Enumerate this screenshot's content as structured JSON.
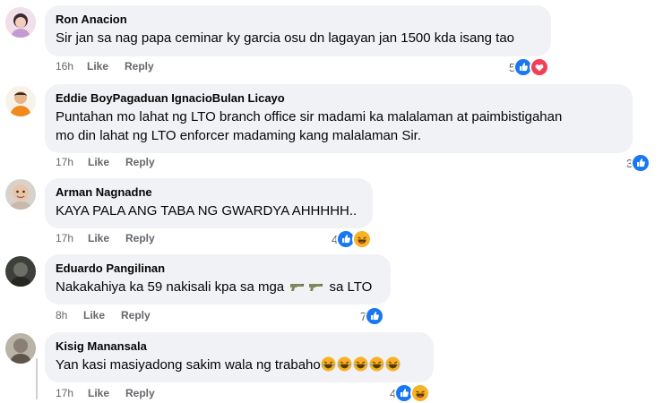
{
  "comments": [
    {
      "author": "Ron Anacion",
      "text": "Sir jan sa nag papa ceminar ky garcia osu dn lagayan jan 1500 kda isang tao",
      "time": "16h",
      "like_label": "Like",
      "reply_label": "Reply",
      "reaction_count": "5",
      "reactions": [
        "like-icon",
        "love-icon"
      ]
    },
    {
      "author": "Eddie BoyPagaduan IgnacioBulan Licayo",
      "text_lines": [
        "Puntahan mo lahat ng LTO branch office sir madami ka malalaman at paimbistigahan",
        "mo din lahat ng LTO enforcer madaming kang malalaman Sir."
      ],
      "time": "17h",
      "like_label": "Like",
      "reply_label": "Reply",
      "reaction_count": "3",
      "reactions": [
        "like-icon"
      ]
    },
    {
      "author": "Arman Nagnadne",
      "text": "KAYA PALA ANG TABA NG GWARDYA AHHHHH..",
      "time": "17h",
      "like_label": "Like",
      "reply_label": "Reply",
      "reaction_count": "4",
      "reactions": [
        "like-icon",
        "haha-icon"
      ]
    },
    {
      "author": "Eduardo Pangilinan",
      "text_before": "Nakakahiya ka 59 nakisali kpa sa mga",
      "text_after": "sa LTO",
      "inline_icons": [
        "gun-icon",
        "gun-icon"
      ],
      "time": "8h",
      "like_label": "Like",
      "reply_label": "Reply",
      "reaction_count": "7",
      "reactions": [
        "like-icon"
      ]
    },
    {
      "author": "Kisig Manansala",
      "text": "Yan kasi masiyadong sakim wala ng trabaho",
      "inline_icons": [
        "laughing-emoji-icon",
        "laughing-emoji-icon",
        "laughing-emoji-icon",
        "laughing-emoji-icon",
        "laughing-emoji-icon"
      ],
      "time": "17h",
      "like_label": "Like",
      "reply_label": "Reply",
      "reaction_count": "4",
      "reactions": [
        "like-icon",
        "haha-icon"
      ]
    }
  ],
  "colors": {
    "bubble": "#f0f2f5",
    "meta_text": "#65676b",
    "like_blue": "#1877f2",
    "love_red": "#f33e58",
    "haha_yellow": "#f7b125"
  }
}
